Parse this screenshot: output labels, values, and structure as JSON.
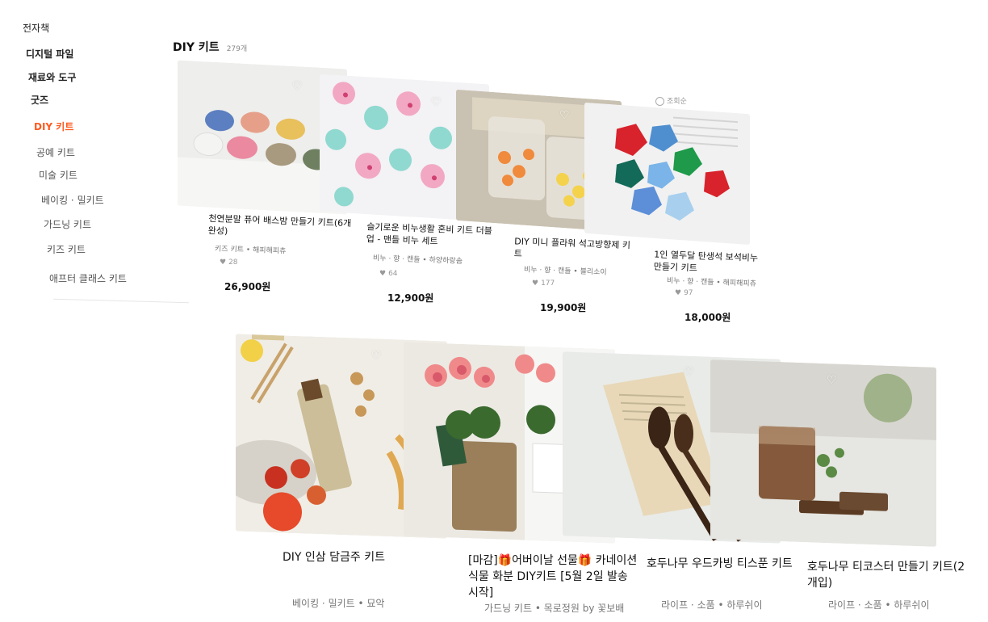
{
  "sidebar": {
    "items": [
      {
        "label": "전자책"
      },
      {
        "label": "디지털 파일"
      },
      {
        "label": "재료와 도구"
      },
      {
        "label": "굿즈"
      },
      {
        "label": "DIY 키트"
      },
      {
        "label": "공예 키트"
      },
      {
        "label": "미술 키트"
      },
      {
        "label": "베이킹 · 밀키트"
      },
      {
        "label": "가드닝 키트"
      },
      {
        "label": "키즈 키트"
      },
      {
        "label": "애프터 클래스 키트"
      }
    ]
  },
  "header": {
    "title": "DIY 키트",
    "count": "279개"
  },
  "sort": {
    "label": "조회순"
  },
  "products": [
    {
      "name": "천연분말 퓨어 배스밤 만들기 키트(6개 완성)",
      "seller": "키즈 키트 • 해피해피츄",
      "likes": "28",
      "price": "26,900원"
    },
    {
      "name": "슬기로운 비누생활 혼비 키트 더블업 - 맨들 비누 세트",
      "seller": "비누 · 향 · 캔들 • 하양하랑솜",
      "likes": "64",
      "price": "12,900원"
    },
    {
      "name": "DIY 미니 플라워 석고방향제 키트",
      "seller": "비누 · 향 · 캔들 • 블리소이",
      "likes": "177",
      "price": "19,900원"
    },
    {
      "name": "1인 열두달 탄생석 보석비누 만들기 키트",
      "seller": "비누 · 향 · 캔들 • 해피해피츄",
      "likes": "97",
      "price": "18,000원"
    },
    {
      "name": "DIY 인삼 담금주 키트",
      "seller": "베이킹 · 밀키트 • 묘악"
    },
    {
      "name": "[마감]🎁어버이날 선물🎁 카네이션 식물 화분 DIY키트 [5월 2일 발송시작]",
      "seller": "가드닝 키트 • 목로정원 by 꽃보배"
    },
    {
      "name": "호두나무 우드카빙 티스푼 키트",
      "seller": "라이프 · 소품 • 하루쉬이"
    },
    {
      "name": "호두나무 티코스터 만들기 키트(2개입)",
      "seller": "라이프 · 소품 • 하루쉬이"
    }
  ]
}
